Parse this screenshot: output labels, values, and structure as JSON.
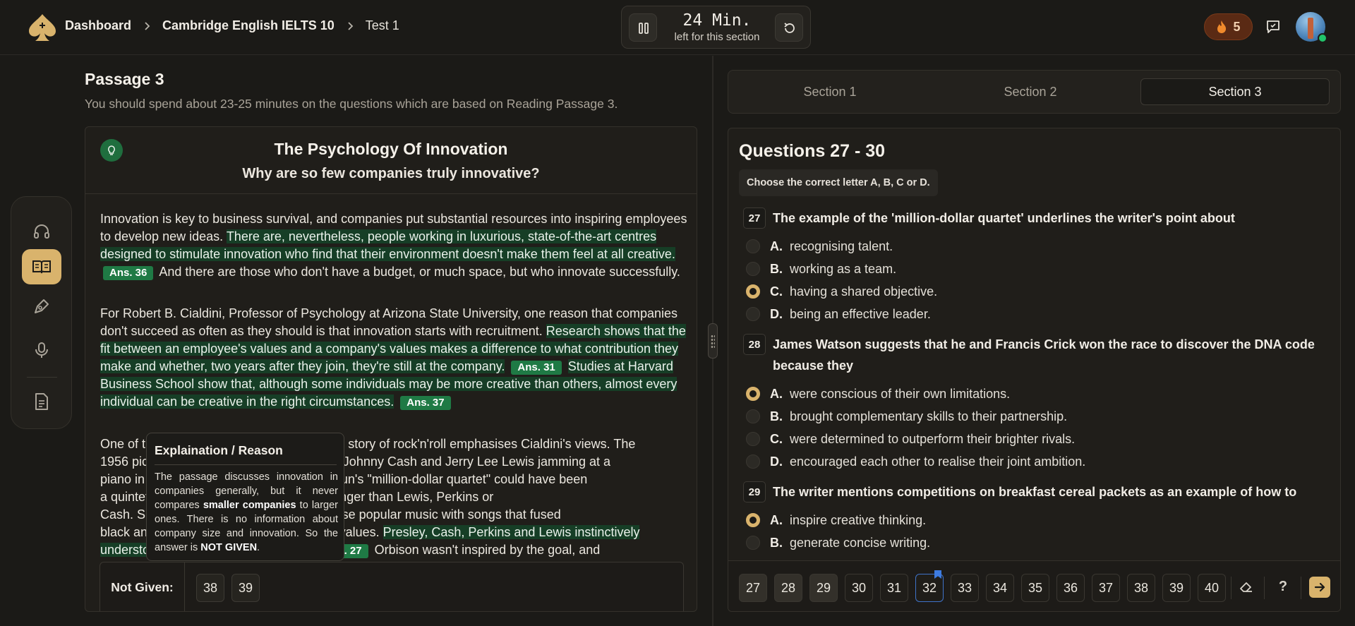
{
  "breadcrumb": [
    "Dashboard",
    "Cambridge English IELTS 10",
    "Test 1"
  ],
  "timer": {
    "time": "24 Min.",
    "subtitle": "left for this section"
  },
  "streak": {
    "count": "5"
  },
  "icons": {
    "logo": "spade-logo-icon",
    "pause": "pause-icon",
    "reset": "reset-icon",
    "fire": "fire-icon",
    "chat": "chat-icon",
    "tools": [
      "headphones-icon",
      "book-open-icon",
      "pen-tool-icon",
      "microphone-icon",
      "document-icon"
    ],
    "eraser": "eraser-icon",
    "help": "question-icon",
    "next": "arrow-right-icon"
  },
  "colors": {
    "accent": "#d9b36c",
    "highlight": "#163e26",
    "answer_badge": "#1f7a45",
    "streak_bg": "#5a2a14"
  },
  "passage": {
    "heading": "Passage 3",
    "instruction": "You should spend about 23-25 minutes on the questions which are based on Reading Passage 3.",
    "title": "The Psychology Of Innovation",
    "subtitle": "Why are so few companies truly innovative?",
    "p1": {
      "a": "Innovation is key to business survival, and companies put substantial resources into inspiring employees to develop new ideas.",
      "b": "There are, nevertheless, people working in luxurious, state-of-the-art centres designed to stimulate innovation who find that their environment doesn't make them feel at all creative.",
      "ans": "Ans. 36",
      "c": "And there are those who don't have a budget, or much space, but who innovate successfully."
    },
    "p2": {
      "a": "For Robert B. Cialdini, Professor of Psychology at Arizona State University, one reason that companies don't succeed as often as they should is that innovation starts with recruitment.",
      "b": "Research shows that the fit between an employee's values and a company's values makes a difference to what contribution they make and whether, two years after they join, they're still at the company.",
      "ans1": "Ans. 31",
      "c": "Studies at Harvard Business School show that, although some individuals may be more creative than others, almost every individual can be creative in the right circumstances.",
      "ans2": "Ans. 37"
    },
    "p3": {
      "l1": "One of the most famous photographs in the story of rock'n'roll emphasises Cialdini's views. The",
      "l2": "1956 picture of Elvis Presley, Carl Perkins, Johnny Cash and Jerry Lee Lewis jamming at a",
      "l3": "piano in Sun Studios tells a hidden story. Sun's \"million-dollar quartet\" could have been",
      "l4": "a quintet: Roy Orbison, a greater natural singer than Lewis, Perkins or",
      "l5": "Cash. Sun's producer wanted to revolutionise popular music with songs that fused",
      "l6a": "black and white music with the company's values.",
      "l6b": "Presley, Cash, Perkins and Lewis instinctively",
      "l7a": "understood the goal and believed in it.",
      "ans": "Ans. 27",
      "l7b": "Orbison wasn't inspired by the goal, and"
    }
  },
  "tooltip": {
    "title": "Explaination / Reason",
    "t1": "The passage discusses innovation in companies generally, but it never compares ",
    "bold1": "smaller companies",
    "t2": " to larger ones. There is no information about company size and innovation. So the answer is ",
    "bold2": "NOT GIVEN",
    "t3": "."
  },
  "not_given": {
    "label": "Not Given:",
    "items": [
      "38",
      "39"
    ]
  },
  "sections": [
    "Section 1",
    "Section 2",
    "Section 3"
  ],
  "questions_header": "Questions 27 - 30",
  "questions_instruction": "Choose the correct letter A, B, C or D.",
  "questions": [
    {
      "num": "27",
      "text": "The example of the 'million-dollar quartet' underlines the writer's point about",
      "options": [
        {
          "letter": "A.",
          "text": "recognising talent."
        },
        {
          "letter": "B.",
          "text": "working as a team."
        },
        {
          "letter": "C.",
          "text": "having a shared objective."
        },
        {
          "letter": "D.",
          "text": "being an effective leader."
        }
      ],
      "selected": "C"
    },
    {
      "num": "28",
      "text": "James Watson suggests that he and Francis Crick won the race to discover the DNA code because they",
      "options": [
        {
          "letter": "A.",
          "text": "were conscious of their own limitations."
        },
        {
          "letter": "B.",
          "text": "brought complementary skills to their partnership."
        },
        {
          "letter": "C.",
          "text": "were determined to outperform their brighter rivals."
        },
        {
          "letter": "D.",
          "text": "encouraged each other to realise their joint ambition."
        }
      ],
      "selected": "A"
    },
    {
      "num": "29",
      "text": "The writer mentions competitions on breakfast cereal packets as an example of how to",
      "options": [
        {
          "letter": "A.",
          "text": "inspire creative thinking."
        },
        {
          "letter": "B.",
          "text": "generate concise writing."
        }
      ],
      "selected": "A"
    }
  ],
  "question_nav": [
    "27",
    "28",
    "29",
    "30",
    "31",
    "32",
    "33",
    "34",
    "35",
    "36",
    "37",
    "38",
    "39",
    "40"
  ],
  "help_label": "?"
}
